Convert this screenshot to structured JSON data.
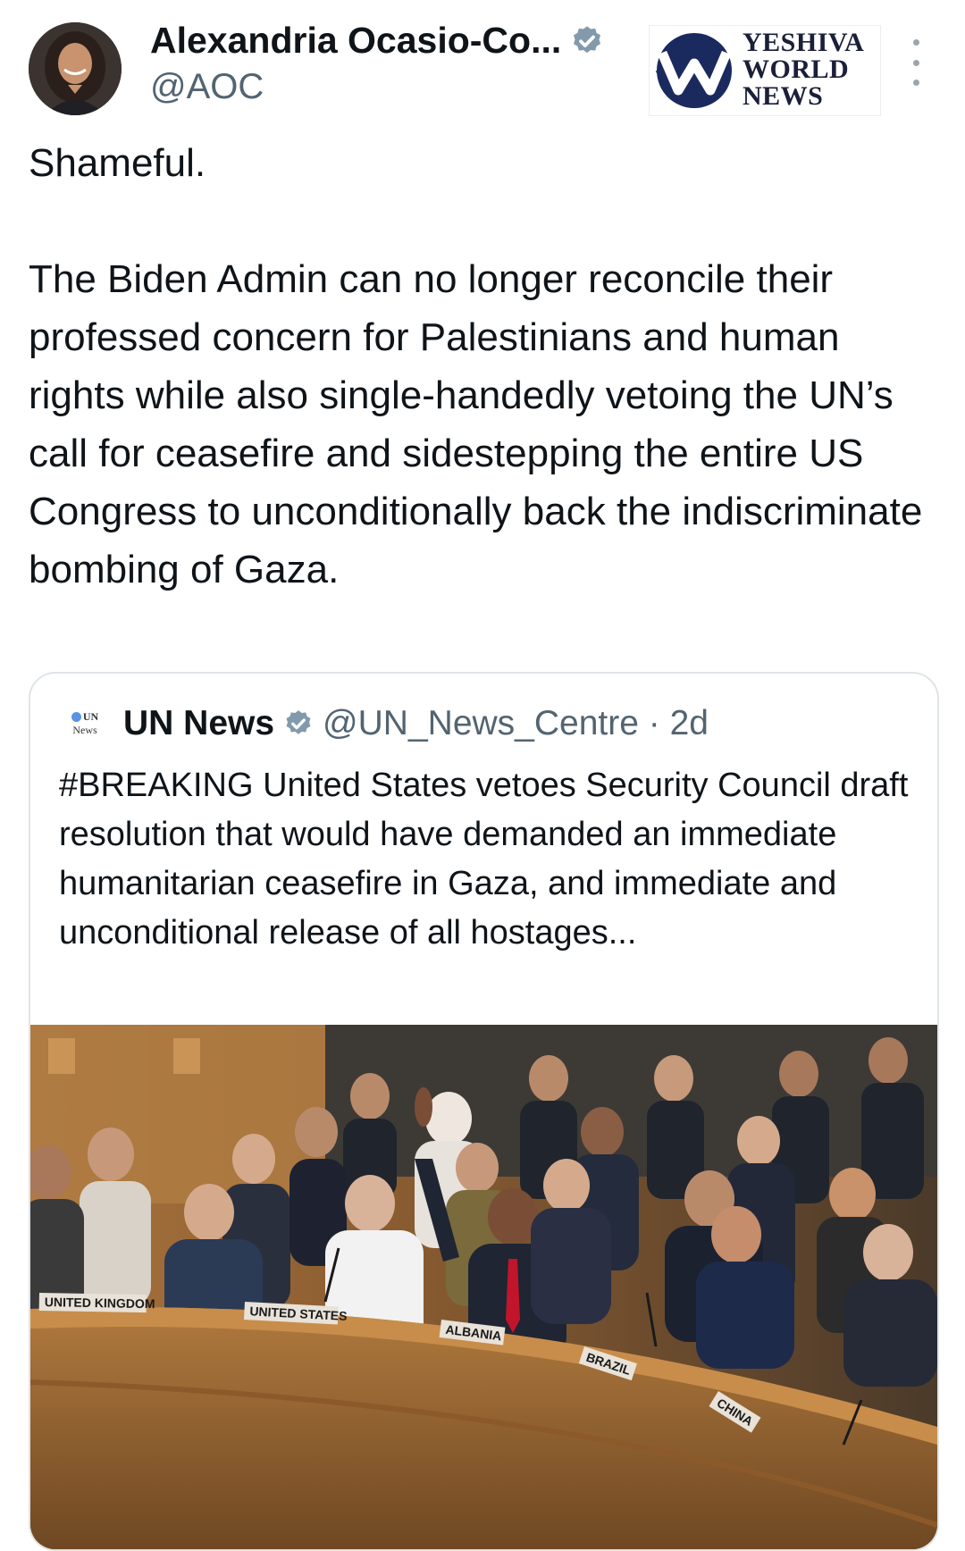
{
  "author": {
    "name": "Alexandria Ocasio-Co...",
    "handle": "@AOC"
  },
  "watermark": {
    "lines": [
      "YESHIVA",
      "WORLD",
      "NEWS"
    ]
  },
  "tweet": {
    "paragraphs": [
      "Shameful.",
      "The Biden Admin can no longer reconcile their professed concern for Palestinians and human rights while also single-handedly vetoing the UN’s call for ceasefire and sidestepping the entire US Congress to unconditionally back the indiscriminate bombing of Gaza."
    ]
  },
  "quote": {
    "logo_line1": "UN",
    "logo_line2": "News",
    "name": "UN News",
    "handle_time": "@UN_News_Centre · 2d",
    "text": "#BREAKING United States vetoes Security Council draft resolution that would have demanded an immediate humanitarian ceasefire in Gaza, and immediate and unconditional release of all hostages...",
    "image_placards": [
      "UNITED KINGDOM",
      "UNITED STATES",
      "ALBANIA",
      "BRAZIL",
      "CHINA"
    ]
  },
  "colors": {
    "verified_badge": "#829aab",
    "handle_gray": "#536471",
    "card_border": "#dfe4e8"
  }
}
